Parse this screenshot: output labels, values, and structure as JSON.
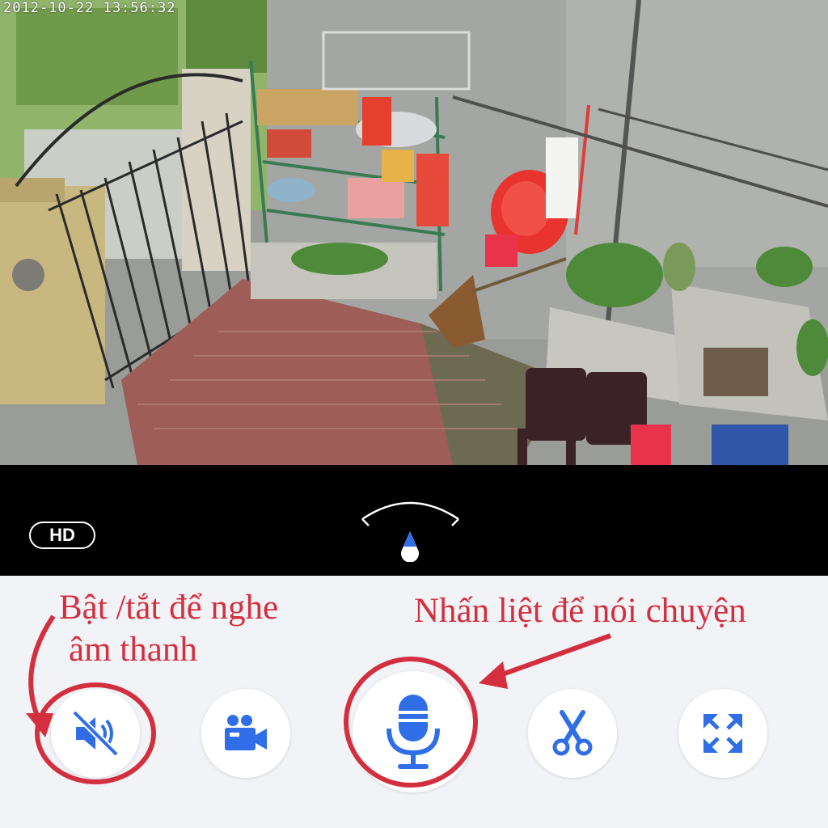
{
  "camera_feed": {
    "timestamp": "2012-10-22  13:56:32"
  },
  "controls": {
    "quality_label": "HD",
    "direction_indicator_icon": "pan-direction-arc-icon"
  },
  "toolbar": {
    "mute_icon": "speaker-muted-icon",
    "record_icon": "video-camera-icon",
    "talk_icon": "microphone-icon",
    "clip_icon": "scissors-icon",
    "fullscreen_icon": "expand-arrows-icon"
  },
  "annotations": {
    "left_line1": "Bật /tắt để nghe",
    "left_line2": "âm thanh",
    "right": "Nhấn liệt để nói chuyện",
    "color": "#d32f3f"
  },
  "colors": {
    "icon_blue": "#2f6ee6",
    "strip_black": "#000000",
    "panel_bg": "#f2f3f7"
  }
}
